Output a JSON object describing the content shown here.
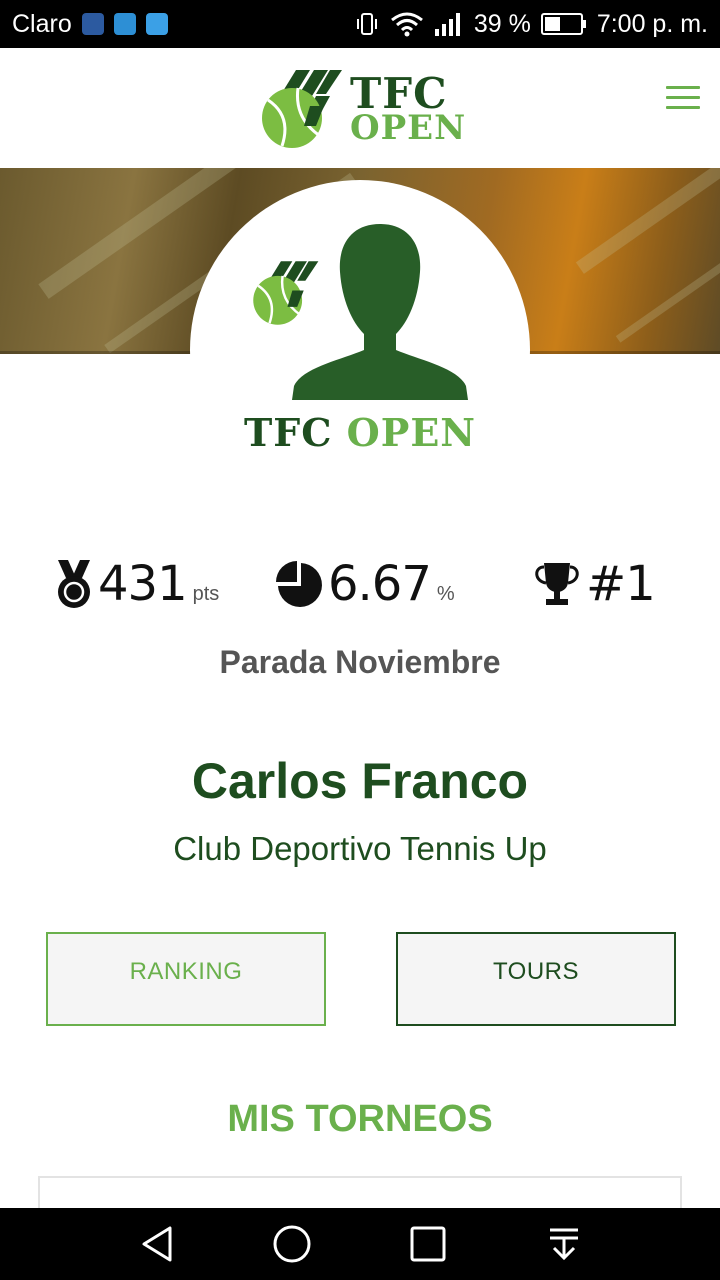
{
  "status_bar": {
    "carrier": "Claro",
    "battery": "39 %",
    "time": "7:00 p. m."
  },
  "header": {
    "logo_line1": "TFC",
    "logo_line2": "OPEN"
  },
  "profile": {
    "brand_part1": "TFC",
    "brand_part2": "OPEN"
  },
  "stats": {
    "points": {
      "value": "431",
      "unit": "pts"
    },
    "percent": {
      "value": "6.67",
      "unit": "%"
    },
    "rank": {
      "value": "#1"
    }
  },
  "period": "Parada Noviembre",
  "player": {
    "name": "Carlos Franco",
    "club": "Club Deportivo Tennis Up"
  },
  "buttons": {
    "ranking": "RANKING",
    "tours": "TOURS"
  },
  "sections": {
    "my_tournaments": "MIS TORNEOS"
  },
  "colors": {
    "dark_green": "#1e4d1f",
    "light_green": "#6ab04c"
  }
}
